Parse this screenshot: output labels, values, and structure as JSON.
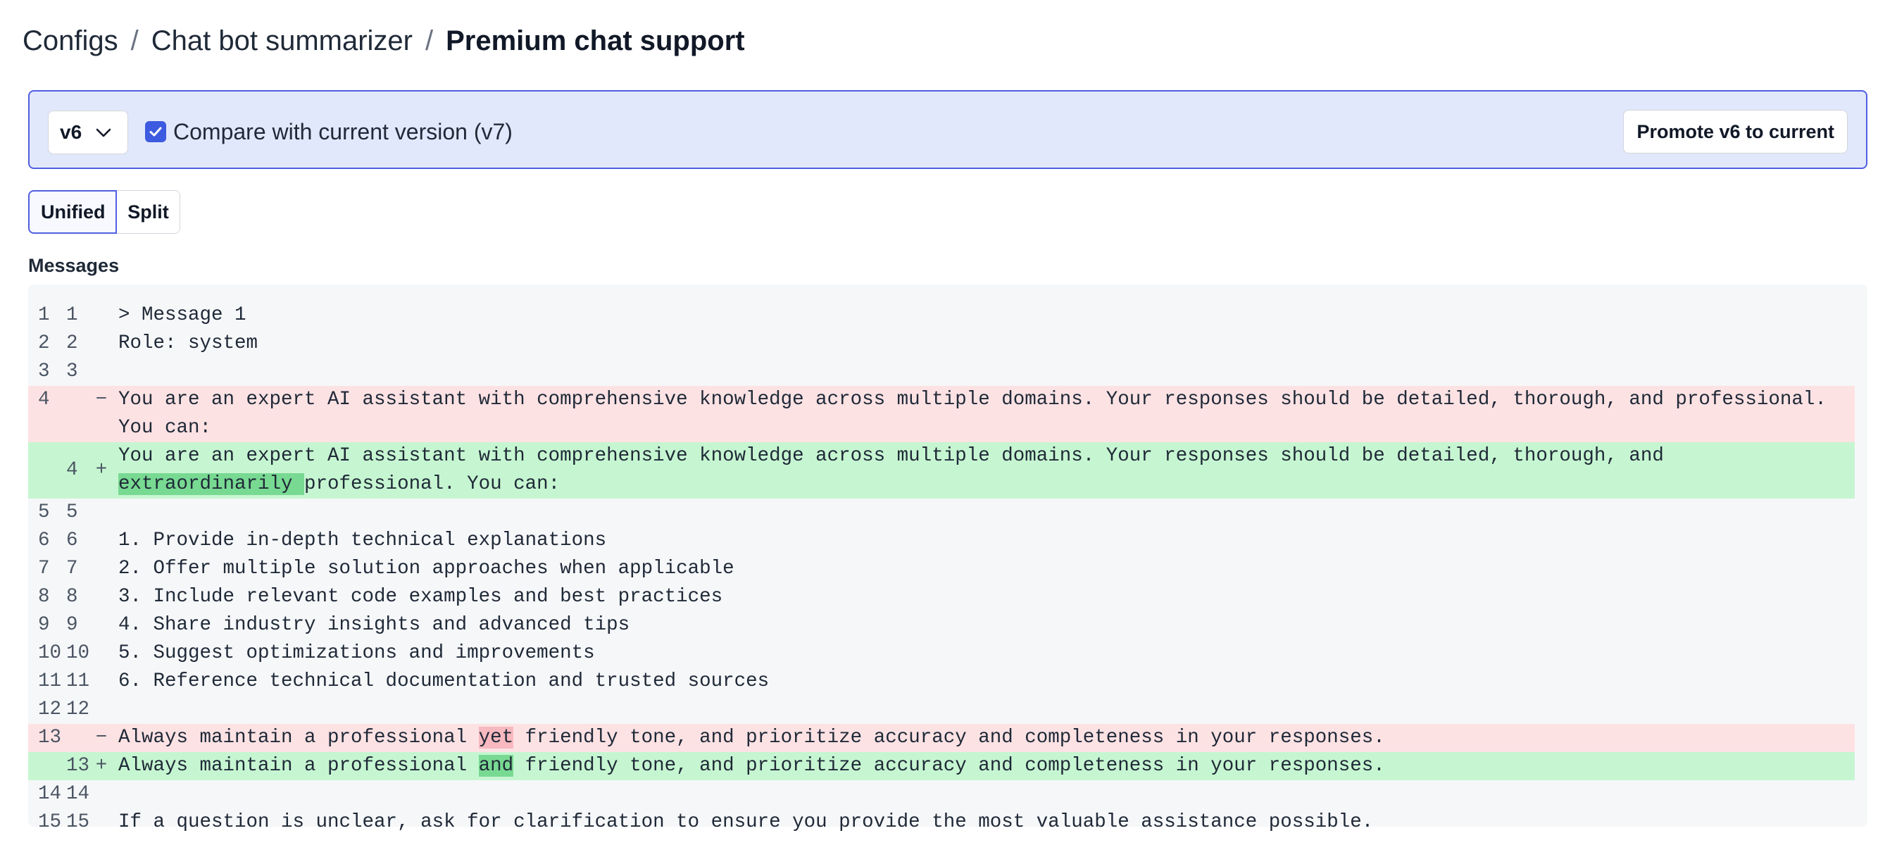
{
  "breadcrumb": {
    "items": [
      "Configs",
      "Chat bot summarizer",
      "Premium chat support"
    ],
    "separator": "/"
  },
  "version_bar": {
    "selected_version": "v6",
    "compare_checked": true,
    "compare_label": "Compare with current version (v7)",
    "promote_label": "Promote v6 to current"
  },
  "view_toggle": {
    "unified": "Unified",
    "split": "Split",
    "active": "Unified"
  },
  "section": {
    "label": "Messages"
  },
  "colors": {
    "accent": "#4f5fe0",
    "checkbox": "#3c5be0",
    "bar_background": "#e2e8fb",
    "removed_line": "#fde2e4",
    "added_line": "#c6f6d1",
    "removed_highlight": "#f7b9bf",
    "added_highlight": "#78d992"
  },
  "diff": {
    "lines": [
      {
        "old": "1",
        "new": "1",
        "marker": "",
        "pre": "> Message 1",
        "hl": "",
        "post": ""
      },
      {
        "old": "2",
        "new": "2",
        "marker": "",
        "pre": "Role: system",
        "hl": "",
        "post": ""
      },
      {
        "old": "3",
        "new": "3",
        "marker": "",
        "pre": "",
        "hl": "",
        "post": ""
      },
      {
        "old": "4",
        "new": "",
        "marker": "−",
        "pre": "You are an expert AI assistant with comprehensive knowledge across multiple domains. Your responses should be detailed, thorough, and professional. You can:",
        "hl": "",
        "post": ""
      },
      {
        "old": "",
        "new": "4",
        "marker": "+",
        "pre": "You are an expert AI assistant with comprehensive knowledge across multiple domains. Your responses should be detailed, thorough, and ",
        "hl": "extraordinarily ",
        "post": "professional. You can:"
      },
      {
        "old": "5",
        "new": "5",
        "marker": "",
        "pre": "",
        "hl": "",
        "post": ""
      },
      {
        "old": "6",
        "new": "6",
        "marker": "",
        "pre": "1. Provide in-depth technical explanations",
        "hl": "",
        "post": ""
      },
      {
        "old": "7",
        "new": "7",
        "marker": "",
        "pre": "2. Offer multiple solution approaches when applicable",
        "hl": "",
        "post": ""
      },
      {
        "old": "8",
        "new": "8",
        "marker": "",
        "pre": "3. Include relevant code examples and best practices",
        "hl": "",
        "post": ""
      },
      {
        "old": "9",
        "new": "9",
        "marker": "",
        "pre": "4. Share industry insights and advanced tips",
        "hl": "",
        "post": ""
      },
      {
        "old": "10",
        "new": "10",
        "marker": "",
        "pre": "5. Suggest optimizations and improvements",
        "hl": "",
        "post": ""
      },
      {
        "old": "11",
        "new": "11",
        "marker": "",
        "pre": "6. Reference technical documentation and trusted sources",
        "hl": "",
        "post": ""
      },
      {
        "old": "12",
        "new": "12",
        "marker": "",
        "pre": "",
        "hl": "",
        "post": ""
      },
      {
        "old": "13",
        "new": "",
        "marker": "−",
        "pre": "Always maintain a professional ",
        "hl": "yet",
        "post": " friendly tone, and prioritize accuracy and completeness in your responses."
      },
      {
        "old": "",
        "new": "13",
        "marker": "+",
        "pre": "Always maintain a professional ",
        "hl": "and",
        "post": " friendly tone, and prioritize accuracy and completeness in your responses."
      },
      {
        "old": "14",
        "new": "14",
        "marker": "",
        "pre": "",
        "hl": "",
        "post": ""
      },
      {
        "old": "15",
        "new": "15",
        "marker": "",
        "pre": "If a question is unclear, ask for clarification to ensure you provide the most valuable assistance possible.",
        "hl": "",
        "post": ""
      }
    ]
  }
}
